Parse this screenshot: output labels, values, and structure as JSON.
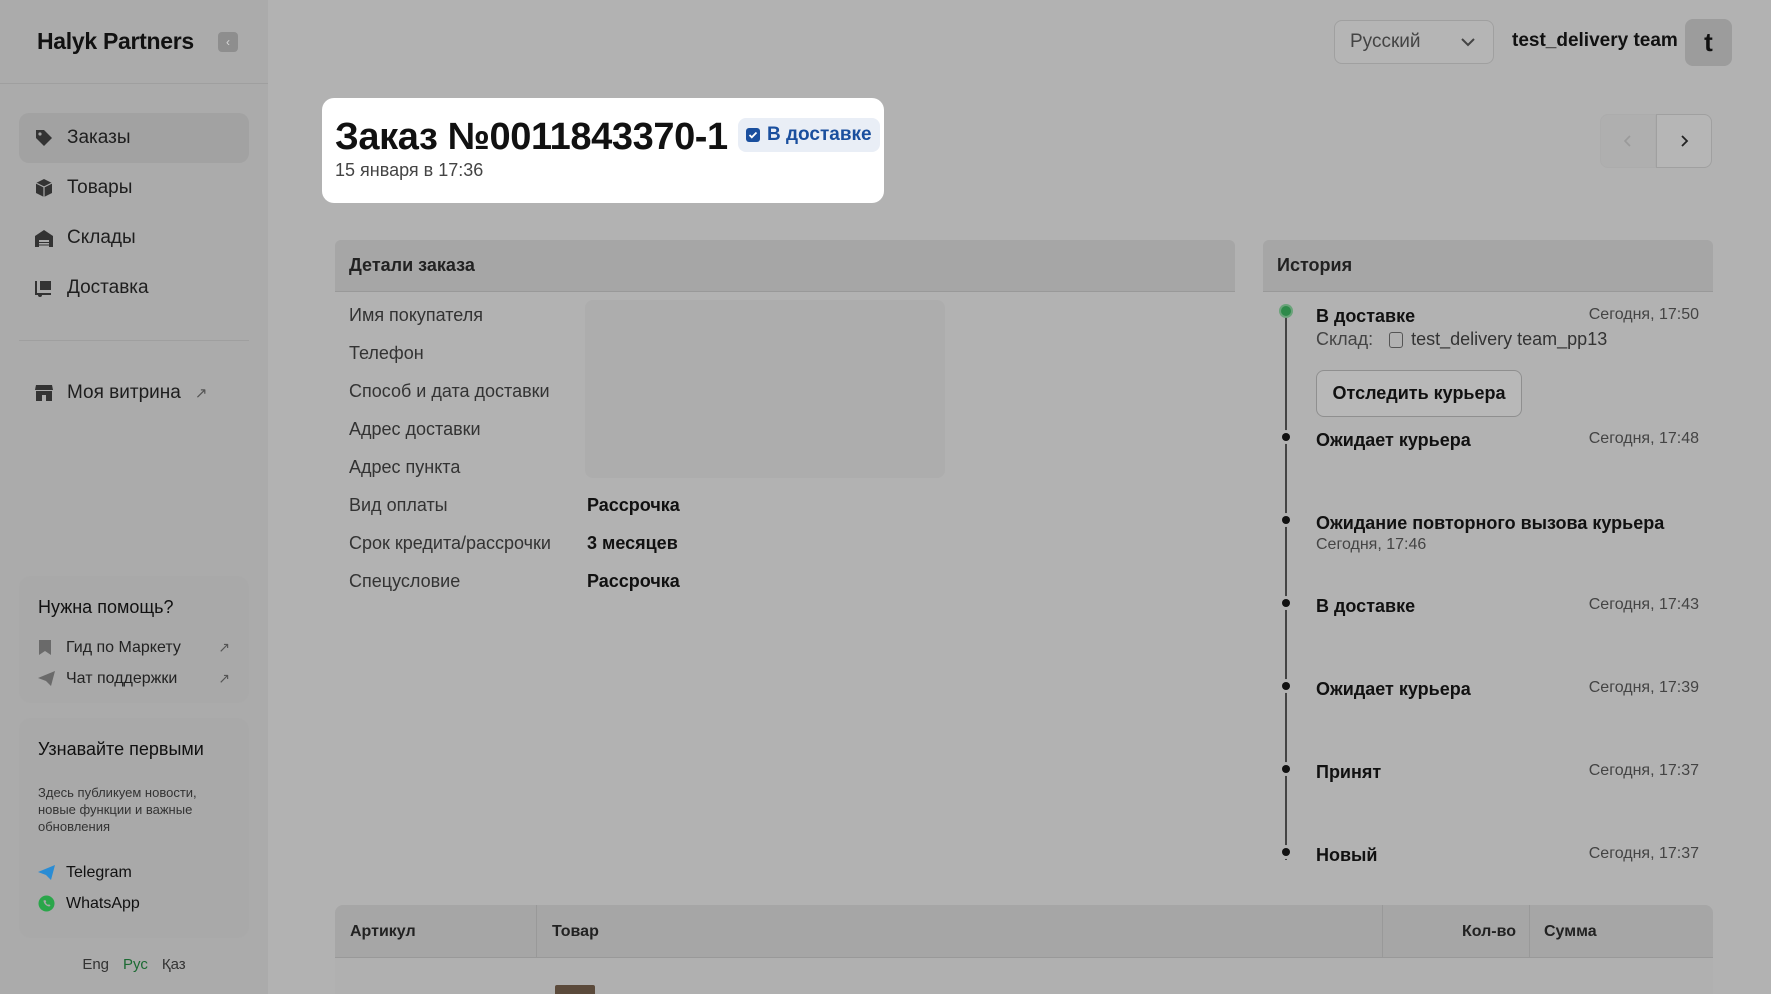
{
  "app": {
    "logo": "Halyk Partners"
  },
  "sidebar": {
    "collapse_icon": "‹",
    "nav": [
      {
        "label": "Заказы",
        "icon": "tag-icon",
        "active": true
      },
      {
        "label": "Товары",
        "icon": "box-icon",
        "active": false
      },
      {
        "label": "Склады",
        "icon": "warehouse-icon",
        "active": false
      },
      {
        "label": "Доставка",
        "icon": "delivery-icon",
        "active": false
      }
    ],
    "storefront": {
      "label": "Моя витрина",
      "icon": "store-icon"
    },
    "help": {
      "title": "Нужна помощь?",
      "links": [
        {
          "label": "Гид по Маркету",
          "icon": "bookmark-icon"
        },
        {
          "label": "Чат поддержки",
          "icon": "send-icon"
        }
      ]
    },
    "news": {
      "title": "Узнавайте первыми",
      "text": "Здесь публикуем новости, новые функции и важные обновления",
      "links": [
        {
          "label": "Telegram",
          "icon": "telegram-icon",
          "color": "#2a8cd4"
        },
        {
          "label": "WhatsApp",
          "icon": "whatsapp-icon",
          "color": "#2aa64a"
        }
      ]
    },
    "languages": [
      "Eng",
      "Рус",
      "Қаз"
    ],
    "active_language": "Рус"
  },
  "topbar": {
    "language_select": "Русский",
    "team_name": "test_delivery team",
    "avatar_letter": "t"
  },
  "order": {
    "title": "Заказ №0011843370-1",
    "status": "В доставке",
    "date": "15 января в 17:36"
  },
  "details": {
    "heading": "Детали заказа",
    "rows": [
      {
        "label": "Имя покупателя",
        "value": ""
      },
      {
        "label": "Телефон",
        "value": ""
      },
      {
        "label": "Способ и дата доставки",
        "value": ""
      },
      {
        "label": "Адрес доставки",
        "value": ""
      },
      {
        "label": "Адрес пункта",
        "value": ""
      },
      {
        "label": "Вид оплаты",
        "value": "Рассрочка"
      },
      {
        "label": "Срок кредита/рассрочки",
        "value": "3 месяцев"
      },
      {
        "label": "Спецусловие",
        "value": "Рассрочка"
      }
    ]
  },
  "history": {
    "heading": "История",
    "warehouse_label": "Склад:",
    "warehouse_value": "test_delivery team_pp13",
    "track_button": "Отследить курьера",
    "events": [
      {
        "title": "В доставке",
        "time": "Сегодня, 17:50",
        "current": true
      },
      {
        "title": "Ожидает курьера",
        "time": "Сегодня, 17:48"
      },
      {
        "title": "Ожидание повторного вызова курьера",
        "time": "Сегодня, 17:46"
      },
      {
        "title": "В доставке",
        "time": "Сегодня, 17:43"
      },
      {
        "title": "Ожидает курьера",
        "time": "Сегодня, 17:39"
      },
      {
        "title": "Принят",
        "time": "Сегодня, 17:37"
      },
      {
        "title": "Новый",
        "time": "Сегодня, 17:37"
      }
    ]
  },
  "items_table": {
    "columns": [
      "Артикул",
      "Товар",
      "Кол-во",
      "Сумма"
    ]
  },
  "colors": {
    "status_badge_text": "#1a4f9e",
    "current_event_dot": "#2e8a4a"
  }
}
